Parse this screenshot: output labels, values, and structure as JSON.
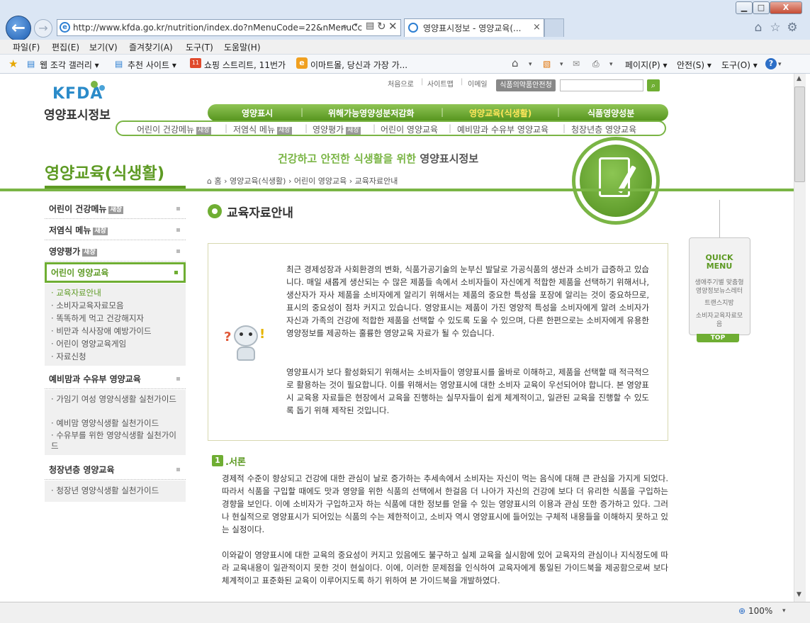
{
  "window": {
    "buttons": {
      "minimize": "▁",
      "maximize": "□",
      "close": "X"
    }
  },
  "browser": {
    "address": "http://www.kfda.go.kr/nutrition/index.do?nMenuCode=22&nMenuCc",
    "tab_title": "영양표시정보 - 영양교육(...",
    "tab_close": "×",
    "menus": [
      "파일(F)",
      "편집(E)",
      "보기(V)",
      "즐겨찾기(A)",
      "도구(T)",
      "도움말(H)"
    ],
    "favorites": [
      "웹 조각 갤러리 ▾",
      "추천 사이트 ▾",
      "쇼핑 스트리트, 11번가",
      "이마트몰, 당신과 가장 가..."
    ],
    "commands": [
      "페이지(P) ▾",
      "안전(S) ▾",
      "도구(O) ▾"
    ],
    "zoom": "100%"
  },
  "site": {
    "logo_en": "KFDA",
    "logo_kr": "영양표시정보",
    "top_links": [
      "처음으로",
      "사이트맵",
      "이메일"
    ],
    "agency_button": "식품의약품안전청",
    "search_placeholder": "",
    "gnav": [
      "영양표시",
      "위해가능영양성분저감화",
      "영양교육(식생활)",
      "식품영양성분"
    ],
    "subnav": [
      {
        "label": "어린이 건강메뉴",
        "badge": "새창"
      },
      {
        "label": "저염식 메뉴",
        "badge": "새창"
      },
      {
        "label": "영양평가",
        "badge": "새창"
      },
      {
        "label": "어린이 영양교육",
        "badge": ""
      },
      {
        "label": "예비맘과 수유부 영양교육",
        "badge": ""
      },
      {
        "label": "청장년층 영양교육",
        "badge": ""
      }
    ],
    "section_title": "영양교육(식생활)",
    "slogan_a": "건강하고",
    "slogan_b": "안전한 식생활을 위한",
    "slogan_c": "영양표시정보",
    "breadcrumb": [
      "홈",
      "영양교육(식생활)",
      "어린이 영양교육",
      "교육자료안내"
    ]
  },
  "leftnav": {
    "items": [
      {
        "label": "어린이 건강메뉴",
        "badge": "새창"
      },
      {
        "label": "저염식 메뉴",
        "badge": "새창"
      },
      {
        "label": "영양평가",
        "badge": "새창"
      },
      {
        "label": "어린이 영양교육",
        "badge": ""
      }
    ],
    "children_kids": [
      "교육자료안내",
      "소비자교육자료모음",
      "똑똑하게 먹고 건강해지자",
      "비만과 식사장애 예방가이드",
      "어린이 영양교육게임",
      "자료신청"
    ],
    "maternal": "예비맘과 수유부 영양교육",
    "children_maternal": [
      "가임기 여성 영양식생활 실천가이드",
      "예비맘 영양식생활 실천가이드",
      "수유부를 위한 영양식생활 실천가이드"
    ],
    "youth": "청장년층 영양교육",
    "children_youth": [
      "청장년 영양식생활 실천가이드"
    ]
  },
  "main": {
    "title": "교육자료안내",
    "intro_p1": "최근 경제성장과 사회환경의 변화, 식품가공기술의 눈부신 발달로 가공식품의 생산과 소비가 급증하고 있습니다. 매일 새롭게 생산되는 수 많은 제품들 속에서 소비자들이 자신에게 적합한 제품을 선택하기 위해서나, 생산자가 자사 제품을 소비자에게 알리기 위해서는 제품의 중요한 특성을 포장에 알리는 것이 중요하므로, 표시의 중요성이 점차 커지고 있습니다. 영양표시는 제품이 가진 영양적 특성을 소비자에게 알려 소비자가 자신과 가족의 건강에 적합한 제품을 선택할 수 있도록 도울 수 있으며, 다른 한편으로는 소비자에게 유용한 영양정보를 제공하는 훌륭한 영양교육 자료가 될 수 있습니다.",
    "intro_p2": "영양표시가 보다 활성화되기 위해서는 소비자들이 영양표시를 올바로 이해하고, 제품을 선택할 때 적극적으로 활용하는 것이 필요합니다. 이를 위해서는 영양표시에 대한 소비자 교육이 우선되어야 합니다. 본 영양표시 교육용 자료들은 현장에서 교육을 진행하는 실무자들이 쉽게 체계적이고, 일관된 교육을 진행할 수 있도록 돕기 위해 제작된 것입니다.",
    "sec1_num": "1",
    "sec1_title": "서론",
    "sec1_p1": "경제적 수준이 향상되고 건강에 대한 관심이 날로 증가하는 추세속에서 소비자는 자신이 먹는 음식에 대해 큰 관심을 가지게 되었다. 따라서 식품을 구입할 때에도 맛과 영양을 위한 식품의 선택에서 한걸음 더 나아가 자신의 건강에 보다 더 유리한 식품을 구입하는 경향을 보인다. 이에 소비자가 구입하고자 하는 식품에 대한 정보를 얻을 수 있는 영양표시의 이용과 관심 또한 증가하고 있다. 그러나 현실적으로 영양표시가 되어있는 식품의 수는 제한적이고, 소비자 역시 영양표시에 들어있는 구체적 내용들을 이해하지 못하고 있는 실정이다.",
    "sec1_p2": "이와같이 영양표시에 대한 교육의 중요성이 커지고 있음에도 불구하고 실제 교육을 실시함에 있어 교육자의 관심이나 지식정도에 따라 교육내용이 일관적이지 못한 것이 현실이다. 이에, 이러한 문제점을 인식하여 교육자에게 통일된 가이드북을 제공함으로써 보다 체계적이고 표준화된 교육이 이루어지도록 하기 위하여 본 가이드북을 개발하였다."
  },
  "quickmenu": {
    "title": "QUICK MENU",
    "items": [
      "생애주기별 맞춤형 영양정보뉴스레터",
      "트랜스지방",
      "소비자교육자료모음"
    ],
    "top": "TOP"
  },
  "colors": {
    "accent": "#5d9a23",
    "nav_green": "#7ab545",
    "browser_chrome": "#dbe6f4"
  }
}
